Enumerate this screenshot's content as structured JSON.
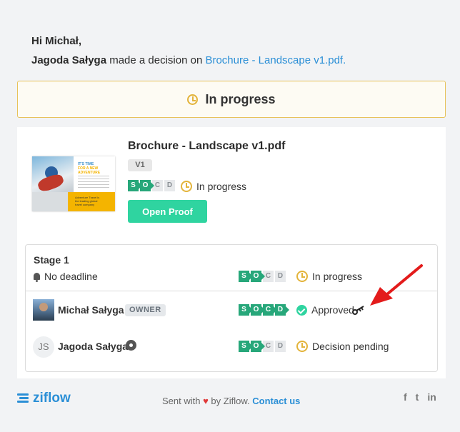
{
  "greeting": {
    "hello": "Hi Michał,",
    "actor": "Jagoda Sałyga",
    "message": " made a decision on ",
    "file_link": "Brochure - Landscape v1.pdf."
  },
  "banner": {
    "status": "In progress",
    "icon": "clock-icon",
    "border_color": "#e7c25a"
  },
  "file": {
    "title": "Brochure - Landscape v1.pdf",
    "version": "V1",
    "steps": [
      "S",
      "O",
      "C",
      "D"
    ],
    "steps_done": 2,
    "status": "In progress",
    "open_button": "Open Proof",
    "thumbnail": {
      "line1": "IT'S TIME",
      "line2": "FOR A NEW ADVENTURE",
      "line3": "Adventure Travel is the leading global travel company"
    }
  },
  "stage": {
    "title": "Stage 1",
    "deadline": "No deadline",
    "steps": [
      "S",
      "O",
      "C",
      "D"
    ],
    "steps_done": 2,
    "status": "In progress",
    "reviewers": [
      {
        "name": "Michał Sałyga",
        "badge": "OWNER",
        "steps_done": 4,
        "status": "Approved",
        "status_icon": "check-circle-icon",
        "extra_icon": "key-icon"
      },
      {
        "name": "Jagoda Sałyga",
        "initials": "JS",
        "steps_done": 2,
        "status": "Decision pending",
        "status_icon": "clock-icon",
        "extra_icon": "gear-icon"
      }
    ]
  },
  "footer": {
    "brand": "ziflow",
    "sent_with": "Sent with ",
    "by": " by Ziflow. ",
    "contact": "Contact us",
    "socials": [
      "f",
      "t",
      "in"
    ]
  },
  "colors": {
    "accent": "#27a77a",
    "button": "#2fd4a0",
    "link": "#2b8fd6",
    "pending": "#e3b43b",
    "annotation_arrow": "#e31b1b"
  }
}
